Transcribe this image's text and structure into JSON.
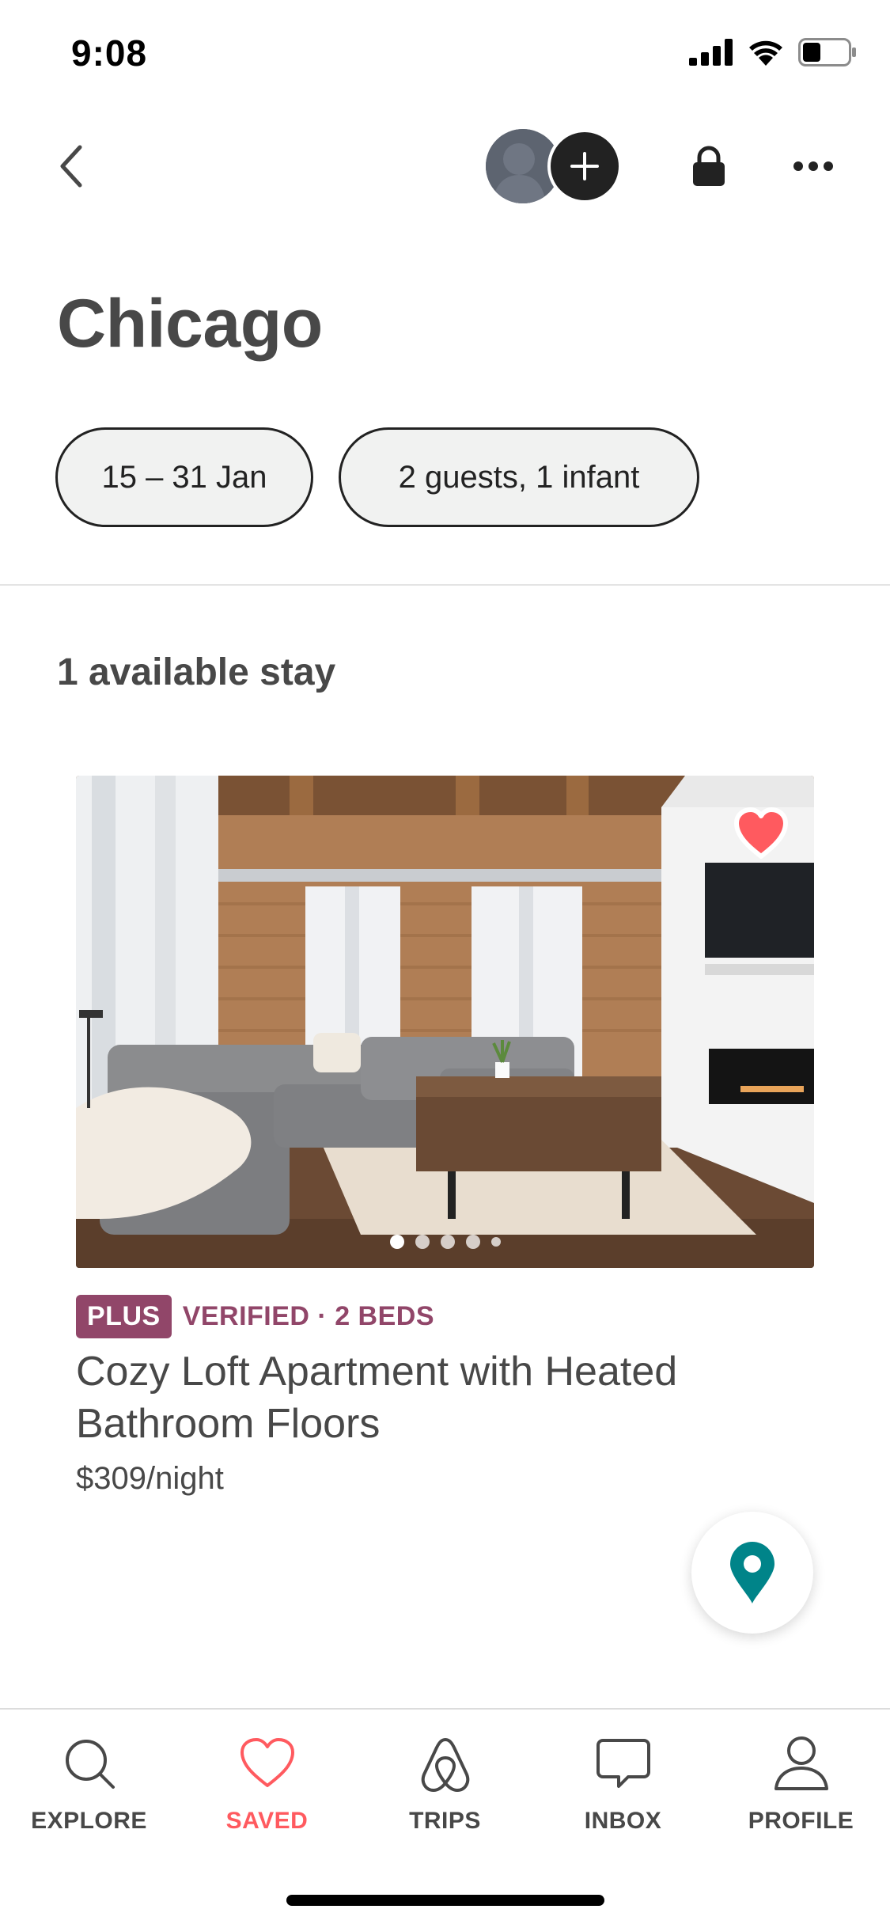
{
  "status_bar": {
    "time": "9:08"
  },
  "header": {
    "back_icon": "chevron-left-icon",
    "avatar_icon": "person-silhouette-icon",
    "add_icon": "plus-icon",
    "lock_icon": "lock-icon",
    "more_icon": "ellipsis-icon"
  },
  "page": {
    "title": "Chicago",
    "filters": {
      "dates": "15 – 31 Jan",
      "guests": "2 guests, 1 infant"
    },
    "stay_count": "1 available stay"
  },
  "listing": {
    "badge": "PLUS",
    "verified": "VERIFIED · 2 BEDS",
    "title": "Cozy Loft Apartment with Heated Bathroom Floors",
    "price": "$309/night",
    "saved": true,
    "photo_count": 5,
    "current_photo": 1
  },
  "tabs": [
    {
      "label": "EXPLORE",
      "icon": "search-icon",
      "active": false
    },
    {
      "label": "SAVED",
      "icon": "heart-icon",
      "active": true
    },
    {
      "label": "TRIPS",
      "icon": "airbnb-logo-icon",
      "active": false
    },
    {
      "label": "INBOX",
      "icon": "chat-bubble-icon",
      "active": false
    },
    {
      "label": "PROFILE",
      "icon": "person-icon",
      "active": false
    }
  ],
  "colors": {
    "accent": "#ff5a5f",
    "plus_badge": "#914669",
    "map_pin": "#008489",
    "text": "#484848"
  }
}
